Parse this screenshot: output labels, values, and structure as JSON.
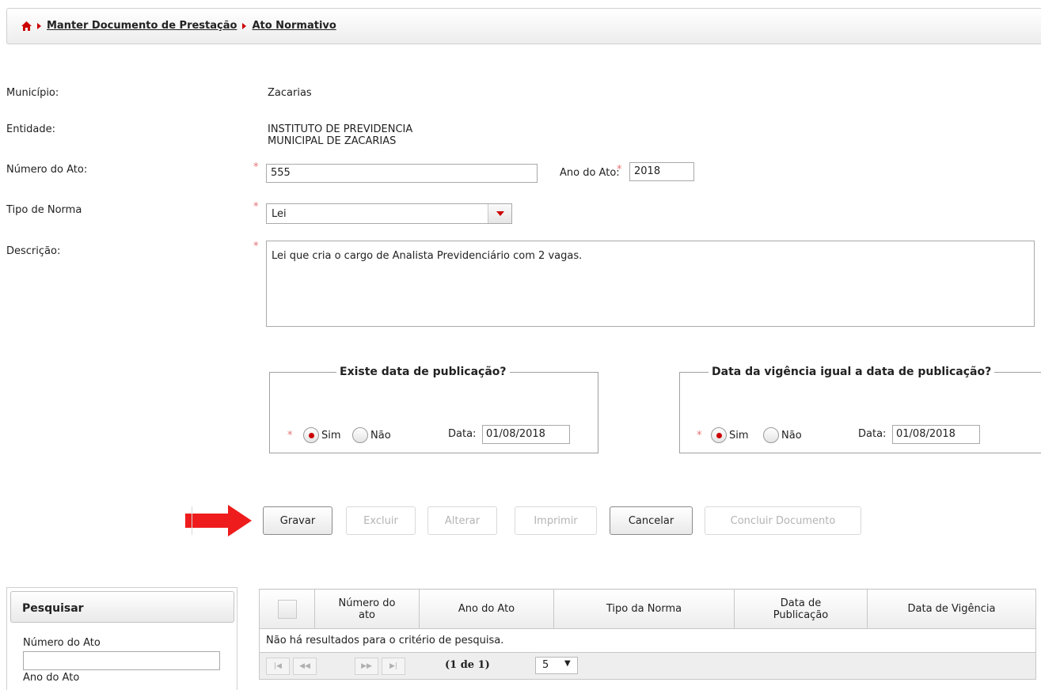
{
  "breadcrumb": {
    "home_icon": "home-icon",
    "items": [
      {
        "label": "Manter Documento de Prestação"
      },
      {
        "label": "Ato Normativo"
      }
    ]
  },
  "form": {
    "municipio": {
      "label": "Município:",
      "value": "Zacarias"
    },
    "entidade": {
      "label": "Entidade:",
      "value_line1": "INSTITUTO DE PREVIDENCIA",
      "value_line2": "MUNICIPAL DE ZACARIAS"
    },
    "numero_ato": {
      "label": "Número do Ato:",
      "value": "555"
    },
    "ano_ato": {
      "label": "Ano do Ato:",
      "value": "2018"
    },
    "tipo_norma": {
      "label": "Tipo de Norma",
      "value": "Lei"
    },
    "descricao": {
      "label": "Descrição:",
      "value": "Lei que cria o cargo de Analista Previdenciário com 2 vagas."
    },
    "required_mark": "*"
  },
  "publicacao": {
    "legend": "Existe data de publicação?",
    "sim": "Sim",
    "nao": "Não",
    "selected": "Sim",
    "data_label": "Data:",
    "data_value": "01/08/2018"
  },
  "vigencia": {
    "legend": "Data da vigência igual a data de publicação?",
    "sim": "Sim",
    "nao": "Não",
    "selected": "Sim",
    "data_label": "Data:",
    "data_value": "01/08/2018"
  },
  "buttons": {
    "gravar": "Gravar",
    "excluir": "Excluir",
    "alterar": "Alterar",
    "imprimir": "Imprimir",
    "cancelar": "Cancelar",
    "concluir": "Concluir Documento"
  },
  "annotation": {
    "arrow_color": "#ee1c1c"
  },
  "search": {
    "title": "Pesquisar",
    "numero_label": "Número do Ato",
    "numero_value": "",
    "ano_label": "Ano do Ato"
  },
  "results": {
    "columns": [
      {
        "line1": "Número do",
        "line2": "ato"
      },
      {
        "line1": "Ano do Ato",
        "line2": ""
      },
      {
        "line1": "Tipo da Norma",
        "line2": ""
      },
      {
        "line1": "Data de",
        "line2": "Publicação"
      },
      {
        "line1": "Data de Vigência",
        "line2": ""
      }
    ],
    "empty_message": "Não há resultados para o critério de pesquisa.",
    "pager": {
      "page_info": "(1 de 1)",
      "rows_per_page": "5"
    }
  },
  "colors": {
    "accent_red": "#cc0000",
    "required": "#e57373",
    "arrow": "#ee1c1c"
  }
}
